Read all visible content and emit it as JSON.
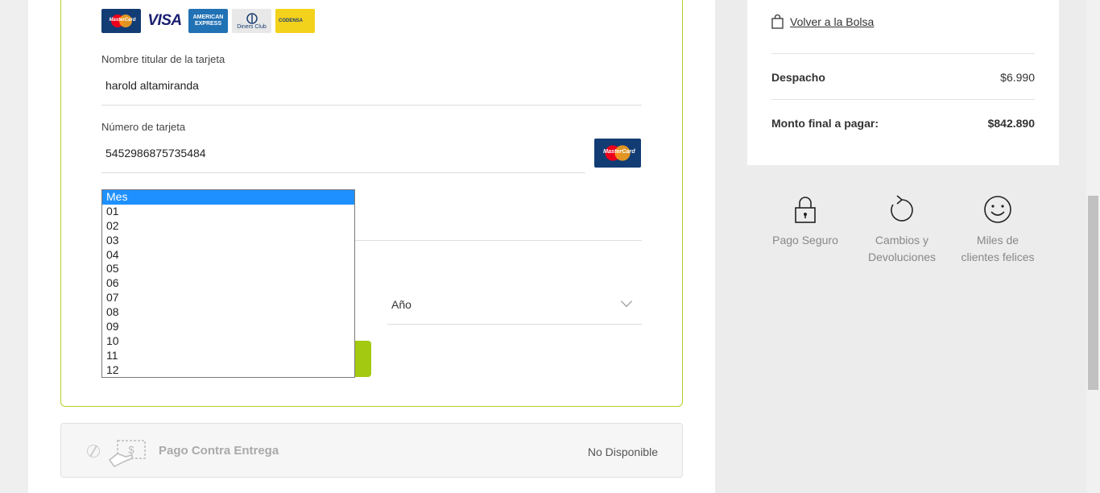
{
  "payment_form": {
    "card_brands": [
      "MasterCard",
      "VISA",
      "American Express",
      "Diners Club",
      "Codensa"
    ],
    "cardholder_label": "Nombre titular de la tarjeta",
    "cardholder_value": "harold altamiranda",
    "card_number_label": "Número de tarjeta",
    "card_number_value": "5452986875735484",
    "detected_brand": "MasterCard",
    "month_options": [
      "Mes",
      "01",
      "02",
      "03",
      "04",
      "05",
      "06",
      "07",
      "08",
      "09",
      "10",
      "11",
      "12"
    ],
    "month_selected": "Mes",
    "year_placeholder": "Año"
  },
  "brand_text": {
    "visa": "VISA",
    "amex": "AMERICAN EXPRESS",
    "diners": "Diners Club",
    "codensa": "CODENSA",
    "mastercard": "MasterCard"
  },
  "cash_on_delivery": {
    "title": "Pago Contra Entrega",
    "status": "No Disponible"
  },
  "summary": {
    "back_link": "Volver a la Bolsa",
    "shipping_label": "Despacho",
    "shipping_value": "$6.990",
    "total_label": "Monto final a pagar:",
    "total_value": "$842.890"
  },
  "features": [
    {
      "icon": "lock-icon",
      "line1": "Pago Seguro",
      "line2": ""
    },
    {
      "icon": "refresh-icon",
      "line1": "Cambios y",
      "line2": "Devoluciones"
    },
    {
      "icon": "smiley-icon",
      "line1": "Miles de",
      "line2": "clientes felices"
    }
  ],
  "colors": {
    "accent_green": "#a3c910",
    "border_green": "#b8cc2a",
    "selection_blue": "#1e90ff"
  }
}
